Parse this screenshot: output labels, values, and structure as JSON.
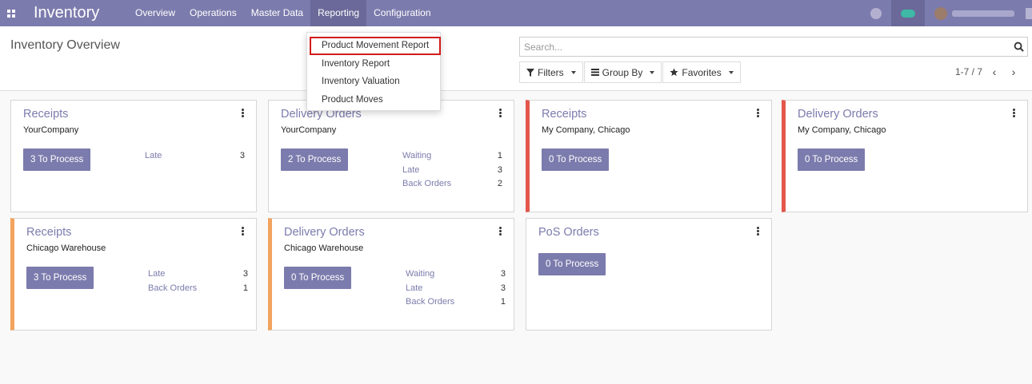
{
  "navbar": {
    "brand": "Inventory",
    "menu": [
      "Overview",
      "Operations",
      "Master Data",
      "Reporting",
      "Configuration"
    ]
  },
  "control": {
    "title": "Inventory Overview",
    "search_placeholder": "Search...",
    "filters": "Filters",
    "group_by": "Group By",
    "favorites": "Favorites",
    "pager": "1-7 / 7"
  },
  "reporting_menu": [
    "Product Movement Report",
    "Inventory Report",
    "Inventory Valuation",
    "Product Moves"
  ],
  "cards": [
    {
      "title": "Receipts",
      "company": "YourCompany",
      "button": "3 To Process",
      "accent": "none",
      "stats": [
        {
          "label": "Late",
          "value": "3"
        }
      ]
    },
    {
      "title": "Delivery Orders",
      "company": "YourCompany",
      "button": "2 To Process",
      "accent": "none",
      "stats": [
        {
          "label": "Waiting",
          "value": "1"
        },
        {
          "label": "Late",
          "value": "3"
        },
        {
          "label": "Back Orders",
          "value": "2"
        }
      ]
    },
    {
      "title": "Receipts",
      "company": "My Company, Chicago",
      "button": "0 To Process",
      "accent": "red",
      "stats": []
    },
    {
      "title": "Delivery Orders",
      "company": "My Company, Chicago",
      "button": "0 To Process",
      "accent": "red",
      "stats": []
    },
    {
      "title": "Receipts",
      "company": "Chicago Warehouse",
      "button": "3 To Process",
      "accent": "orange",
      "stats": [
        {
          "label": "Late",
          "value": "3"
        },
        {
          "label": "Back Orders",
          "value": "1"
        }
      ]
    },
    {
      "title": "Delivery Orders",
      "company": "Chicago Warehouse",
      "button": "0 To Process",
      "accent": "orange",
      "stats": [
        {
          "label": "Waiting",
          "value": "3"
        },
        {
          "label": "Late",
          "value": "3"
        },
        {
          "label": "Back Orders",
          "value": "1"
        }
      ]
    },
    {
      "title": "PoS Orders",
      "company": "",
      "button": "0 To Process",
      "accent": "none",
      "stats": []
    }
  ],
  "colors": {
    "primary": "#7c7bad",
    "red_accent": "#e3574c",
    "orange_accent": "#f3a35e",
    "highlight": "#d21b1b"
  }
}
